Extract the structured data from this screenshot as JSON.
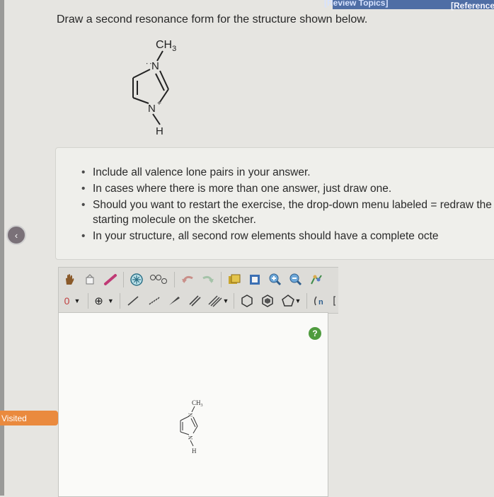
{
  "header": {
    "review_topics": "[Review Topics]",
    "references": "[References"
  },
  "question": {
    "text": "Draw a second resonance form for the structure shown below."
  },
  "molecule": {
    "methyl": "CH",
    "methyl_sub": "3",
    "atom_n1": "N",
    "atom_n2": "N",
    "charge": "+",
    "hydrogen": "H"
  },
  "instructions": [
    "Include all valence lone pairs in your answer.",
    "In cases where there is more than one answer, just draw one.",
    "Should you want to restart the exercise, the drop-down menu labeled = redraw the starting molecule on the sketcher.",
    "In your structure, all second row elements should have a complete octe"
  ],
  "sidebar": {
    "visited_label": "Visited"
  },
  "toolbar": {
    "charge_value": "0",
    "add_label": "⊕",
    "help_label": "?"
  },
  "sketch": {
    "methyl": "CH",
    "methyl_sub": "3",
    "hydrogen": "H"
  },
  "colors": {
    "accent": "#4f6ea5",
    "visited": "#ea8a3e",
    "help": "#4f9b3e"
  },
  "icons": [
    "hand-icon",
    "eraser-icon",
    "pencil-icon",
    "ring-template-icon",
    "chain-icon",
    "undo-icon",
    "redo-icon",
    "copy-icon",
    "paste-icon",
    "zoom-in-icon",
    "zoom-out-icon",
    "clean-icon",
    "single-bond-icon",
    "wedge-bond-icon",
    "double-bond-icon",
    "triple-bond-icon",
    "hexagon-icon",
    "benzene-icon",
    "pentagon-icon",
    "sgroup-icon",
    "bracket-icon"
  ]
}
